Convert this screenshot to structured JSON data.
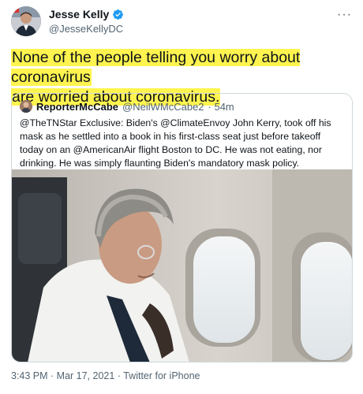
{
  "tweet": {
    "author_name": "Jesse Kelly",
    "author_handle": "@JesseKellyDC",
    "more_label": "···",
    "text_line1": "None of the people telling you worry about coronavirus",
    "text_line2": "are worried about coronavirus.",
    "timestamp": "3:43 PM · Mar 17, 2021",
    "separator": " · ",
    "source": "Twitter for iPhone"
  },
  "quoted": {
    "author_name": "ReporterMcCabe",
    "author_handle": "@NeilWMcCabe2",
    "time": "· 54m",
    "text": "@TheTNStar Exclusive: Biden's @ClimateEnvoy John Kerry, took off his mask as he settled into a book in his first-class seat just before takeoff today on an @AmericanAir flight Boston to DC. He was not eating, nor drinking. He was simply flaunting Biden's mandatory mask policy."
  },
  "icons": {
    "verified": "verified-badge-icon",
    "more": "more-options-icon"
  },
  "colors": {
    "highlight": "#fff44f",
    "verified": "#1d9bf0",
    "muted_text": "#536471",
    "border": "#cfd9de"
  }
}
